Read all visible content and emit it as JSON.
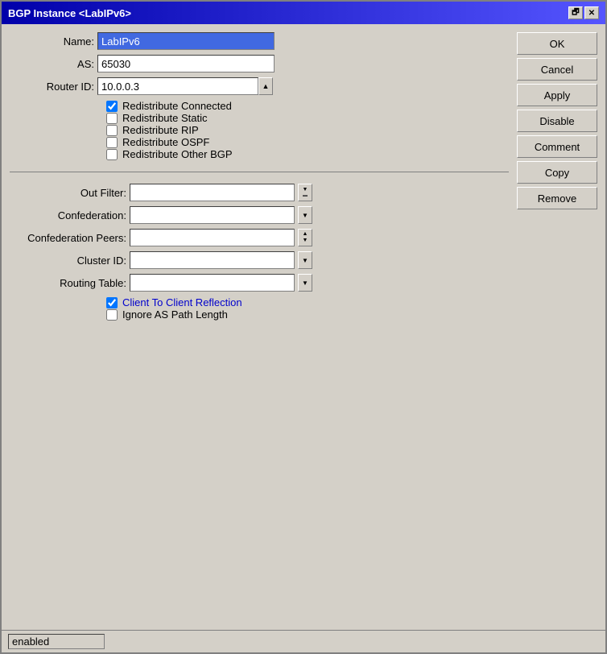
{
  "window": {
    "title": "BGP Instance <LabIPv6>"
  },
  "title_controls": {
    "restore_label": "🗗",
    "close_label": "✕"
  },
  "form": {
    "name_label": "Name:",
    "name_value": "LabIPv6",
    "as_label": "AS:",
    "as_value": "65030",
    "router_id_label": "Router ID:",
    "router_id_value": "10.0.0.3",
    "checkboxes": [
      {
        "id": "redistribute-connected",
        "label": "Redistribute Connected",
        "checked": true
      },
      {
        "id": "redistribute-static",
        "label": "Redistribute Static",
        "checked": false
      },
      {
        "id": "redistribute-rip",
        "label": "Redistribute RIP",
        "checked": false
      },
      {
        "id": "redistribute-ospf",
        "label": "Redistribute OSPF",
        "checked": false
      },
      {
        "id": "redistribute-other-bgp",
        "label": "Redistribute Other BGP",
        "checked": false
      }
    ],
    "out_filter_label": "Out Filter:",
    "out_filter_value": "",
    "confederation_label": "Confederation:",
    "confederation_value": "",
    "confederation_peers_label": "Confederation Peers:",
    "confederation_peers_value": "",
    "cluster_id_label": "Cluster ID:",
    "cluster_id_value": "",
    "routing_table_label": "Routing Table:",
    "routing_table_value": "",
    "bottom_checkboxes": [
      {
        "id": "client-to-client",
        "label": "Client To Client Reflection",
        "checked": true
      },
      {
        "id": "ignore-as-path",
        "label": "Ignore AS Path Length",
        "checked": false
      }
    ]
  },
  "buttons": {
    "ok_label": "OK",
    "cancel_label": "Cancel",
    "apply_label": "Apply",
    "disable_label": "Disable",
    "comment_label": "Comment",
    "copy_label": "Copy",
    "remove_label": "Remove"
  },
  "status": {
    "text": "enabled"
  }
}
